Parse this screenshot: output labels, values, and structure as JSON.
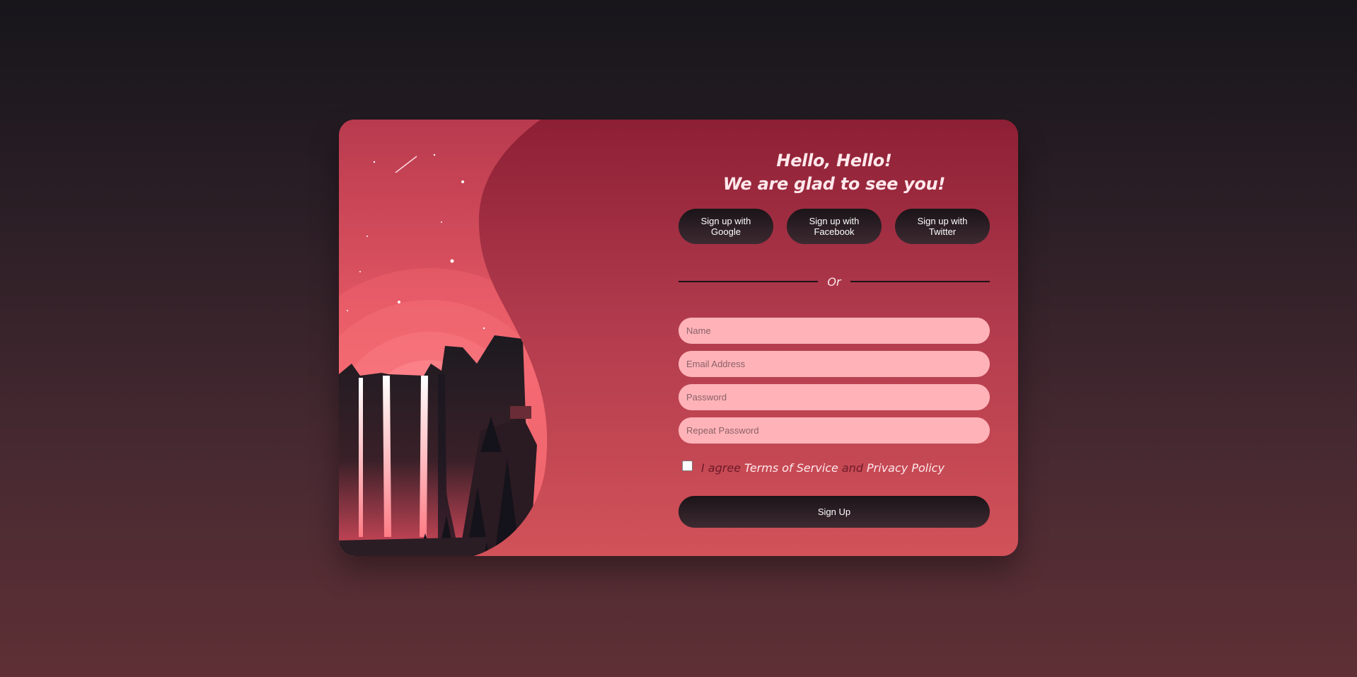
{
  "heading": {
    "line1": "Hello, Hello!",
    "line2": "We are glad to see you!"
  },
  "social": {
    "google": "Sign up with Google",
    "facebook": "Sign up with Facebook",
    "twitter": "Sign up with Twitter"
  },
  "divider": {
    "label": "Or"
  },
  "fields": {
    "name_placeholder": "Name",
    "email_placeholder": "Email Address",
    "password_placeholder": "Password",
    "repeat_password_placeholder": "Repeat Password"
  },
  "agree": {
    "prefix": "I agree",
    "terms": "Terms of Service",
    "and": "and",
    "privacy": "Privacy Policy"
  },
  "submit_label": "Sign Up",
  "colors": {
    "card_top": "#8d1f35",
    "card_bottom": "#d25259",
    "input_bg": "#ffb3b8",
    "button_dark": "#1a1418"
  }
}
